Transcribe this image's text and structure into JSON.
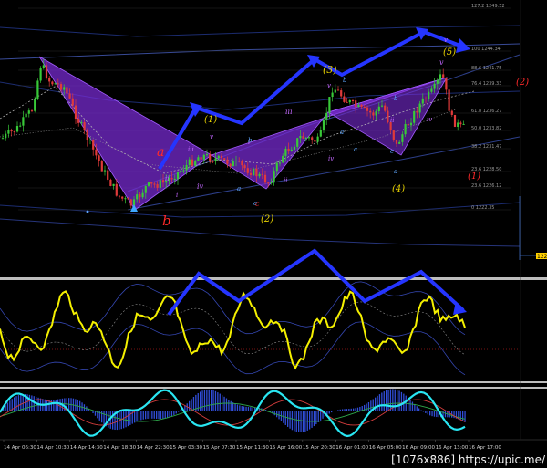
{
  "watermark": "[1076x886] https://upic.me/",
  "colors": {
    "background": "#000000",
    "bull": "#38c938",
    "bear": "#e03a3a",
    "pattern_fill": "#7a2bd6",
    "arrow": "#2535ff",
    "osc_main": "#f4f000",
    "osc2_main": "#29e6f2",
    "osc2_hist": "#3a5cff",
    "wave_yellow": "#e8d200",
    "wave_purple": "#c266ff",
    "wave_blue": "#5fa8ff",
    "wave_red": "#ff2a2a"
  },
  "chart_data": {
    "type": "candlestick",
    "x_labels": [
      "14 Apr 06:30",
      "14 Apr 10:30",
      "14 Apr 14:30",
      "14 Apr 18:30",
      "14 Apr 22:30",
      "15 Apr 03:30",
      "15 Apr 07:30",
      "15 Apr 11:30",
      "15 Apr 16:00",
      "15 Apr 20:30",
      "16 Apr 01:00",
      "16 Apr 05:00",
      "16 Apr 09:00",
      "16 Apr 13:00",
      "16 Apr 17:00"
    ],
    "level_labels": [
      "127.2 1249.52",
      "100 1244.34",
      "88.6 1241.75",
      "76.4 1239.33",
      "61.8 1236.27",
      "50.0 1233.82",
      "38.2 1231.47",
      "23.6 1228.50",
      "23.6 1226.12",
      "0 1222.35"
    ],
    "price_tag": "1222",
    "wave_labels": [
      {
        "text": "(1)",
        "color": "#e8d200"
      },
      {
        "text": "(2)",
        "color": "#e8d200"
      },
      {
        "text": "(3)",
        "color": "#e8d200"
      },
      {
        "text": "(4)",
        "color": "#e8d200"
      },
      {
        "text": "(5)",
        "color": "#e8d200"
      },
      {
        "text": "(1)",
        "color": "#ff2a2a"
      },
      {
        "text": "(2)",
        "color": "#ff2a2a"
      },
      {
        "text": "a",
        "color": "#ff2a2a"
      },
      {
        "text": "b",
        "color": "#ff2a2a"
      },
      {
        "text": "c",
        "color": "#ff2a2a"
      },
      {
        "text": "i",
        "color": "#c266ff"
      },
      {
        "text": "ii",
        "color": "#c266ff"
      },
      {
        "text": "iii",
        "color": "#c266ff"
      },
      {
        "text": "iv",
        "color": "#c266ff"
      },
      {
        "text": "v",
        "color": "#c266ff"
      },
      {
        "text": "i",
        "color": "#c266ff"
      },
      {
        "text": "ii",
        "color": "#c266ff"
      },
      {
        "text": "iii",
        "color": "#c266ff"
      },
      {
        "text": "iv",
        "color": "#c266ff"
      },
      {
        "text": "v",
        "color": "#c266ff"
      },
      {
        "text": "ii",
        "color": "#c266ff"
      },
      {
        "text": "iv",
        "color": "#c266ff"
      },
      {
        "text": "v",
        "color": "#c266ff"
      },
      {
        "text": "a",
        "color": "#5fa8ff"
      },
      {
        "text": "b",
        "color": "#5fa8ff"
      },
      {
        "text": "c",
        "color": "#5fa8ff"
      },
      {
        "text": "a",
        "color": "#5fa8ff"
      },
      {
        "text": "b",
        "color": "#5fa8ff"
      },
      {
        "text": "c",
        "color": "#5fa8ff"
      },
      {
        "text": "a",
        "color": "#5fa8ff"
      },
      {
        "text": "b",
        "color": "#5fa8ff"
      },
      {
        "text": "c",
        "color": "#5fa8ff"
      },
      {
        "text": "v",
        "color": "#c266ff"
      }
    ]
  }
}
